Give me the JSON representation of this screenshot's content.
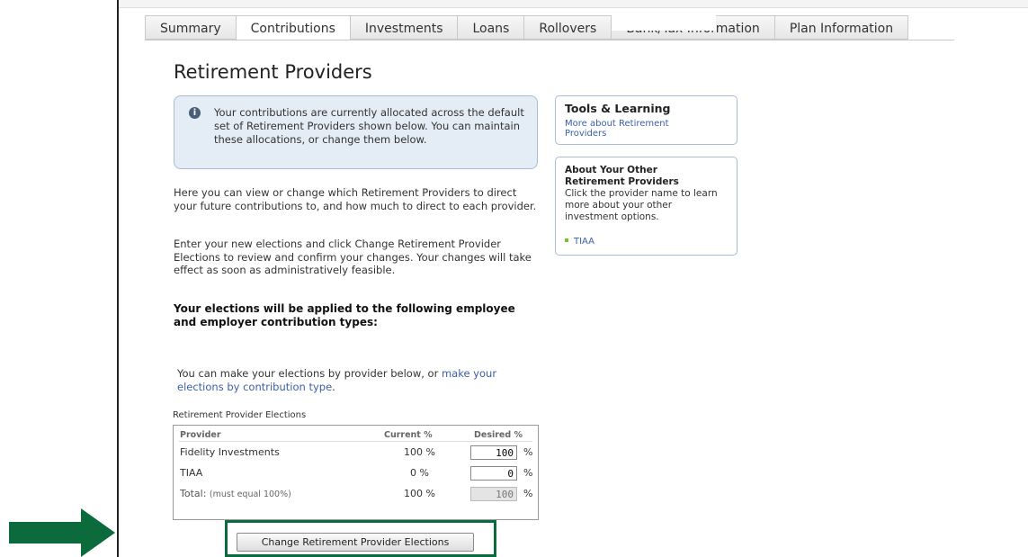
{
  "tabs": [
    {
      "label": "Summary"
    },
    {
      "label": "Contributions",
      "active": true
    },
    {
      "label": "Investments"
    },
    {
      "label": "Loans"
    },
    {
      "label": "Rollovers"
    },
    {
      "label": "Bank/Tax Information"
    },
    {
      "label": "Plan Information"
    }
  ],
  "page_title": "Retirement Providers",
  "info_message": "Your contributions are currently allocated across the default set of Retirement Providers shown below.  You can maintain these allocations, or change them below.",
  "intro_text": "Here you can view or change which Retirement Providers to direct your future contributions to, and how much to direct to each provider.",
  "instructions_text": "Enter your new elections and click Change Retirement Provider Elections to review and confirm your changes. Your changes will take effect as soon as administratively feasible.",
  "elections_heading": "Your elections will be applied to the following employee and employer contribution types:",
  "elections_note_prefix": "You can make your elections by provider below, or ",
  "elections_note_link": "make your elections by contribution type",
  "elections_note_suffix": ".",
  "table": {
    "caption": "Retirement Provider Elections",
    "headers": {
      "provider": "Provider",
      "current": "Current %",
      "desired": "Desired %"
    },
    "rows": [
      {
        "provider": "Fidelity Investments",
        "current": "100 %",
        "desired": "100",
        "unit": "%"
      },
      {
        "provider": "TIAA",
        "current": "0 %",
        "desired": "0",
        "unit": "%"
      }
    ],
    "total": {
      "label": "Total:",
      "note": "(must equal 100%)",
      "current": "100 %",
      "desired": "100",
      "unit": "%"
    }
  },
  "action_button": "Change Retirement Provider Elections",
  "tools": {
    "title": "Tools & Learning",
    "link": "More about Retirement Providers"
  },
  "other_providers": {
    "title": "About Your Other Retirement Providers",
    "body": "Click the provider name to learn more about your other investment options.",
    "links": [
      "TIAA"
    ]
  },
  "colors": {
    "arrow": "#0b6b3c",
    "highlight_border": "#0b6b3c",
    "link": "#3a5fa8",
    "info_bg": "#e4ecf6"
  }
}
